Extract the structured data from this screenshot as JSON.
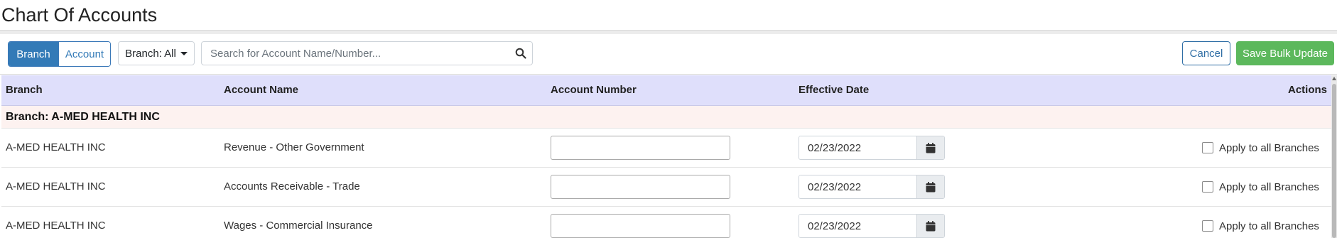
{
  "page": {
    "title": "Chart Of Accounts"
  },
  "toolbar": {
    "view_toggle": {
      "branch_label": "Branch",
      "account_label": "Account",
      "selected": "Branch"
    },
    "branch_filter_label": "Branch: All",
    "search_placeholder": "Search for Account Name/Number...",
    "search_value": "",
    "cancel_label": "Cancel",
    "save_label": "Save Bulk Update"
  },
  "table": {
    "headers": {
      "branch": "Branch",
      "account_name": "Account Name",
      "account_number": "Account Number",
      "effective_date": "Effective Date",
      "actions": "Actions"
    },
    "group_label": "Branch: A-MED HEALTH INC",
    "rows": [
      {
        "branch": "A-MED HEALTH INC",
        "account_name": "Revenue - Other Government",
        "account_number": "",
        "effective_date": "02/23/2022",
        "apply_label": "Apply to all Branches",
        "apply_checked": false
      },
      {
        "branch": "A-MED HEALTH INC",
        "account_name": "Accounts Receivable - Trade",
        "account_number": "",
        "effective_date": "02/23/2022",
        "apply_label": "Apply to all Branches",
        "apply_checked": false
      },
      {
        "branch": "A-MED HEALTH INC",
        "account_name": "Wages - Commercial Insurance",
        "account_number": "",
        "effective_date": "02/23/2022",
        "apply_label": "Apply to all Branches",
        "apply_checked": false
      }
    ]
  },
  "icons": {
    "search": "search-icon",
    "calendar": "calendar-icon",
    "caret": "caret-down-icon"
  },
  "colors": {
    "primary": "#337ab7",
    "success": "#5cb85c",
    "header_bg": "#dfdffb",
    "group_bg": "#fdf2f0"
  }
}
